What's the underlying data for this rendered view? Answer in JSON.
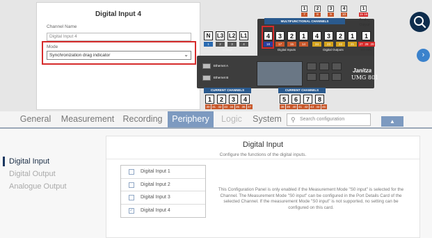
{
  "popup": {
    "title": "Digital Input 4",
    "channel_name_label": "Channel Name",
    "channel_name_value": "Digital Input 4",
    "mode_label": "Mode",
    "mode_value": "Synchronization drag indicator"
  },
  "device": {
    "top_pins": [
      {
        "label": "1",
        "num": "7"
      },
      {
        "label": "2",
        "num": "8"
      },
      {
        "label": "3",
        "num": "9"
      },
      {
        "label": "4",
        "num": "10"
      }
    ],
    "analog_pin": {
      "label": "1",
      "num": "15 16"
    },
    "multi_banner": "MULTIFUNCTIONAL CHANNELS",
    "analog_output_label": "Analog Output",
    "voltage_pins": [
      "N",
      "L3",
      "L2",
      "L1"
    ],
    "voltage_nums": [
      "1",
      "2",
      "3",
      "4"
    ],
    "voltage_label": "Voltage",
    "digital_input_pins": [
      "4",
      "3",
      "2",
      "1"
    ],
    "digital_input_nums": [
      "18",
      "17",
      "15",
      "14"
    ],
    "digital_input_label": "Digital Inputs",
    "digital_output_pins": [
      "4",
      "3",
      "2",
      "1"
    ],
    "digital_output_nums": [
      "24",
      "23",
      "22",
      "21"
    ],
    "digital_output_label": "Digital Outputs",
    "rs485_pin": "1",
    "rs485_nums": [
      "27",
      "28",
      "29"
    ],
    "rs485_label": "RS-485",
    "ethernet_a": "Ethernet A",
    "ethernet_b": "Ethernet B",
    "brand": "Janitza",
    "model": "UMG 801",
    "current_banner": "CURRENT CHANNELS",
    "current_left_pins": [
      "1",
      "2",
      "3",
      "4"
    ],
    "current_left_nums": [
      "30",
      "31",
      "32",
      "33",
      "34",
      "35",
      "36",
      "37"
    ],
    "current_right_pins": [
      "5",
      "6",
      "7",
      "8"
    ],
    "current_right_nums": [
      "38",
      "39",
      "40",
      "41",
      "42",
      "43",
      "44",
      "45"
    ]
  },
  "tabs": [
    {
      "label": "General",
      "state": "normal"
    },
    {
      "label": "Measurement",
      "state": "normal"
    },
    {
      "label": "Recording",
      "state": "normal"
    },
    {
      "label": "Periphery",
      "state": "active"
    },
    {
      "label": "Logic",
      "state": "disabled"
    },
    {
      "label": "System",
      "state": "normal"
    }
  ],
  "search": {
    "placeholder": "Search configuration"
  },
  "nav": [
    {
      "label": "Digital Input",
      "active": true
    },
    {
      "label": "Digital Output",
      "active": false
    },
    {
      "label": "Analogue Output",
      "active": false
    }
  ],
  "panel": {
    "title": "Digital Input",
    "subtitle": "Configure the functions of the digital inputs.",
    "inputs": [
      {
        "label": "Digital Input 1",
        "checked": false
      },
      {
        "label": "Digital Input 2",
        "checked": false
      },
      {
        "label": "Digital Input 3",
        "checked": false
      },
      {
        "label": "Digital Input 4",
        "checked": true
      }
    ],
    "info": "This Configuration Panel is only enabled if the Measurement Mode \"S0 input\" is selected for the Channel. The Measurement Mode \"S0 input\" can be configured in the Port Details Card of the selected Channel. If the measurement Mode \"S0 input\" is not supported, no setting can be configured on this card."
  },
  "colors": {
    "accent": "#7d9ac0",
    "highlight": "#d62b2b",
    "device_blue": "#2a5a8e",
    "search_circle": "#0e2d4d"
  }
}
